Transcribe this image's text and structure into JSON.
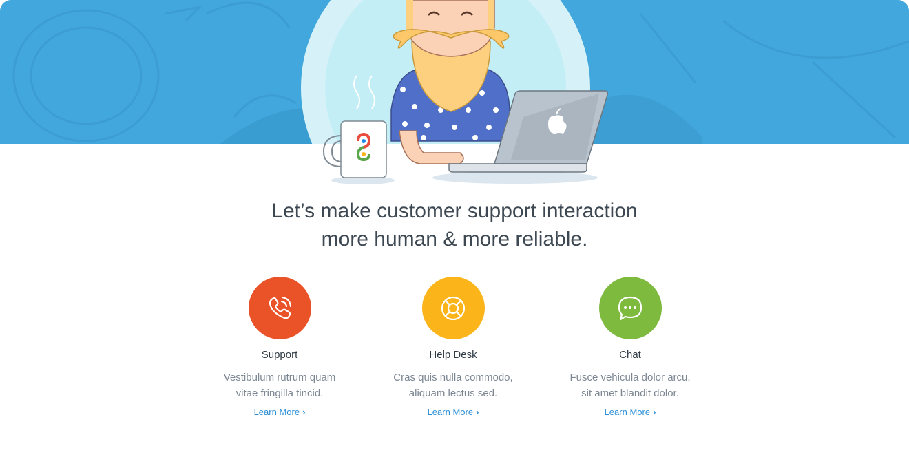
{
  "headline": {
    "line1": "Let’s make customer support interaction",
    "line2": "more human & more reliable."
  },
  "features": [
    {
      "title": "Support",
      "desc1": "Vestibulum rutrum quam",
      "desc2": "vitae fringilla tincid.",
      "link": "Learn More",
      "icon": "phone-icon",
      "color": "#ea5228"
    },
    {
      "title": "Help Desk",
      "desc1": "Cras quis nulla commodo,",
      "desc2": "aliquam lectus sed.",
      "link": "Learn More",
      "icon": "lifebuoy-icon",
      "color": "#fbb41a"
    },
    {
      "title": "Chat",
      "desc1": "Fusce vehicula dolor arcu,",
      "desc2": "sit amet blandit dolor.",
      "link": "Learn More",
      "icon": "chat-bubble-icon",
      "color": "#7dba3d"
    }
  ],
  "colors": {
    "hero": "#42a7dc",
    "link": "#2b8fd6"
  }
}
